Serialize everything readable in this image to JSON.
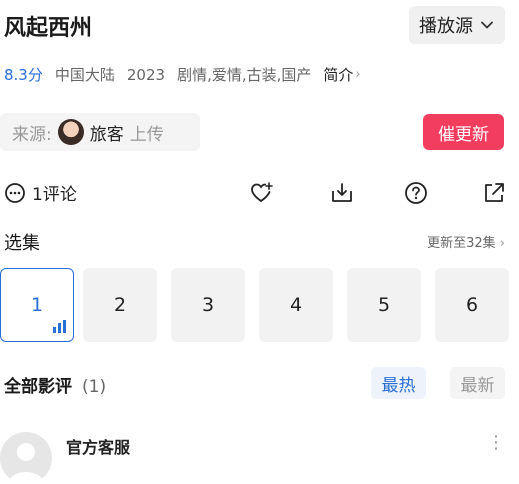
{
  "show": {
    "title": "风起西州",
    "source_button": "播放源",
    "score": "8.3分",
    "region": "中国大陆",
    "year": "2023",
    "genres": "剧情,爱情,古装,国产",
    "intro": "简介"
  },
  "uploader": {
    "label": "来源:",
    "name": "旅客",
    "suffix": "上传"
  },
  "urge_button": "催更新",
  "actions": {
    "comment_count": "1评论",
    "icons": [
      "heart-plus-icon",
      "download-icon",
      "help-icon",
      "share-icon"
    ]
  },
  "episodes": {
    "title": "选集",
    "update_info": "更新至32集",
    "items": [
      "1",
      "2",
      "3",
      "4",
      "5",
      "6"
    ],
    "active_index": 0
  },
  "reviews": {
    "title": "全部影评",
    "count": "(1)",
    "sort_hot": "最热",
    "sort_new": "最新",
    "first": {
      "name": "官方客服"
    }
  },
  "colors": {
    "accent_blue": "#2a6fd6",
    "urge_red": "#f23d5e"
  }
}
